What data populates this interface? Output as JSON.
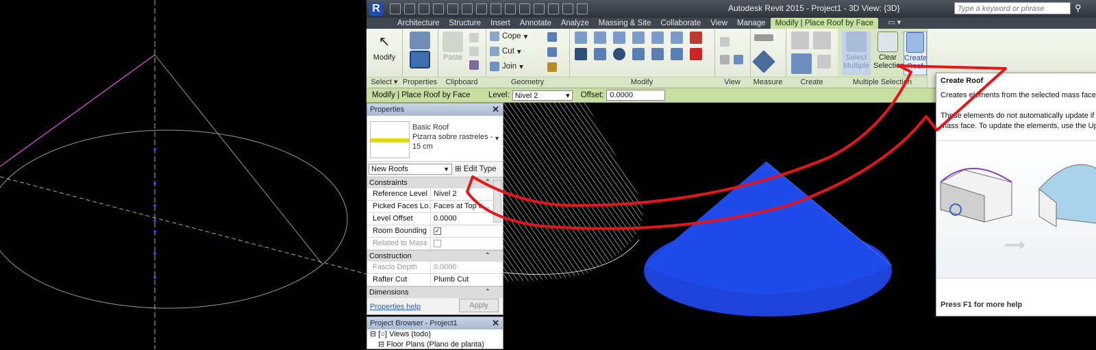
{
  "titlebar": {
    "title": "Autodesk Revit 2015 -   Project1 - 3D View: {3D}",
    "search_placeholder": "Type a keyword or phrase"
  },
  "tabs": [
    {
      "label": "Architecture"
    },
    {
      "label": "Structure"
    },
    {
      "label": "Insert"
    },
    {
      "label": "Annotate"
    },
    {
      "label": "Analyze"
    },
    {
      "label": "Massing & Site"
    },
    {
      "label": "Collaborate"
    },
    {
      "label": "View"
    },
    {
      "label": "Manage"
    },
    {
      "label": "Modify | Place Roof by Face"
    }
  ],
  "ribbon": {
    "select": {
      "button": "Modify",
      "panel": "Select"
    },
    "properties": {
      "panel": "Properties"
    },
    "clipboard": {
      "button": "Paste",
      "panel": "Clipboard"
    },
    "geometry": {
      "cope": "Cope",
      "cut": "Cut",
      "join": "Join",
      "panel": "Geometry"
    },
    "modify": {
      "panel": "Modify"
    },
    "view": {
      "panel": "View"
    },
    "measure": {
      "panel": "Measure"
    },
    "create": {
      "panel": "Create"
    },
    "multiple_selection": {
      "select_multiple_1": "Select",
      "select_multiple_2": "Multiple",
      "clear_selection_1": "Clear",
      "clear_selection_2": "Selection",
      "create_roof_1": "Create",
      "create_roof_2": "Roof",
      "panel": "Multiple Selection"
    }
  },
  "options_bar": {
    "context": "Modify | Place Roof by Face",
    "level_label": "Level:",
    "level_value": "Nivel 2",
    "offset_label": "Offset:",
    "offset_value": "0.0000"
  },
  "properties": {
    "title": "Properties",
    "type_family": "Basic Roof",
    "type_name_1": "Pizarra sobre rastreles -",
    "type_name_2": "15 cm",
    "instance_filter": "New Roofs",
    "edit_type": "Edit Type",
    "groups": {
      "constraints": "Constraints",
      "construction": "Construction",
      "dimensions": "Dimensions"
    },
    "rows": {
      "reference_level": {
        "label": "Reference Level",
        "value": "Nivel 2"
      },
      "picked_faces": {
        "label": "Picked Faces Lo...",
        "value": "Faces at Top o..."
      },
      "level_offset": {
        "label": "Level Offset",
        "value": "0.0000"
      },
      "room_bounding": {
        "label": "Room Bounding",
        "value": "✓"
      },
      "related_to_mass": {
        "label": "Related to Mass",
        "value": ""
      },
      "fascia_depth": {
        "label": "Fascia Depth",
        "value": "0.0000"
      },
      "rafter_cut": {
        "label": "Rafter Cut",
        "value": "Plumb Cut"
      }
    },
    "help_link": "Properties help",
    "apply": "Apply"
  },
  "project_browser": {
    "title": "Project Browser - Project1",
    "views": "Views (todo)",
    "floor_plans": "Floor Plans (Plano de planta)"
  },
  "tooltip": {
    "title": "Create Roof",
    "description": "Creates elements from the selected mass faces.",
    "note_1": "These elements do not automatically update if y",
    "note_2": "mass face. To update the elements, use the Upd",
    "footer": "Press F1 for more help"
  },
  "colors": {
    "context_tab": "#c8dfa3",
    "roof_mass_blue": "#1f4fe0",
    "arrow_red": "#e8141a",
    "edge_magenta": "#d02fd0"
  }
}
